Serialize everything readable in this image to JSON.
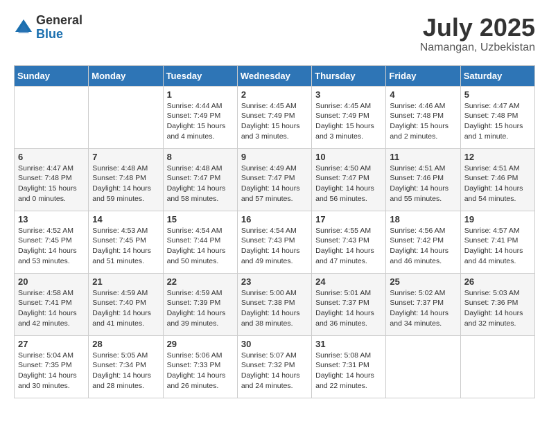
{
  "logo": {
    "general": "General",
    "blue": "Blue"
  },
  "title": "July 2025",
  "location": "Namangan, Uzbekistan",
  "days_header": [
    "Sunday",
    "Monday",
    "Tuesday",
    "Wednesday",
    "Thursday",
    "Friday",
    "Saturday"
  ],
  "weeks": [
    [
      {
        "num": "",
        "sunrise": "",
        "sunset": "",
        "daylight": ""
      },
      {
        "num": "",
        "sunrise": "",
        "sunset": "",
        "daylight": ""
      },
      {
        "num": "1",
        "sunrise": "Sunrise: 4:44 AM",
        "sunset": "Sunset: 7:49 PM",
        "daylight": "Daylight: 15 hours and 4 minutes."
      },
      {
        "num": "2",
        "sunrise": "Sunrise: 4:45 AM",
        "sunset": "Sunset: 7:49 PM",
        "daylight": "Daylight: 15 hours and 3 minutes."
      },
      {
        "num": "3",
        "sunrise": "Sunrise: 4:45 AM",
        "sunset": "Sunset: 7:49 PM",
        "daylight": "Daylight: 15 hours and 3 minutes."
      },
      {
        "num": "4",
        "sunrise": "Sunrise: 4:46 AM",
        "sunset": "Sunset: 7:48 PM",
        "daylight": "Daylight: 15 hours and 2 minutes."
      },
      {
        "num": "5",
        "sunrise": "Sunrise: 4:47 AM",
        "sunset": "Sunset: 7:48 PM",
        "daylight": "Daylight: 15 hours and 1 minute."
      }
    ],
    [
      {
        "num": "6",
        "sunrise": "Sunrise: 4:47 AM",
        "sunset": "Sunset: 7:48 PM",
        "daylight": "Daylight: 15 hours and 0 minutes."
      },
      {
        "num": "7",
        "sunrise": "Sunrise: 4:48 AM",
        "sunset": "Sunset: 7:48 PM",
        "daylight": "Daylight: 14 hours and 59 minutes."
      },
      {
        "num": "8",
        "sunrise": "Sunrise: 4:48 AM",
        "sunset": "Sunset: 7:47 PM",
        "daylight": "Daylight: 14 hours and 58 minutes."
      },
      {
        "num": "9",
        "sunrise": "Sunrise: 4:49 AM",
        "sunset": "Sunset: 7:47 PM",
        "daylight": "Daylight: 14 hours and 57 minutes."
      },
      {
        "num": "10",
        "sunrise": "Sunrise: 4:50 AM",
        "sunset": "Sunset: 7:47 PM",
        "daylight": "Daylight: 14 hours and 56 minutes."
      },
      {
        "num": "11",
        "sunrise": "Sunrise: 4:51 AM",
        "sunset": "Sunset: 7:46 PM",
        "daylight": "Daylight: 14 hours and 55 minutes."
      },
      {
        "num": "12",
        "sunrise": "Sunrise: 4:51 AM",
        "sunset": "Sunset: 7:46 PM",
        "daylight": "Daylight: 14 hours and 54 minutes."
      }
    ],
    [
      {
        "num": "13",
        "sunrise": "Sunrise: 4:52 AM",
        "sunset": "Sunset: 7:45 PM",
        "daylight": "Daylight: 14 hours and 53 minutes."
      },
      {
        "num": "14",
        "sunrise": "Sunrise: 4:53 AM",
        "sunset": "Sunset: 7:45 PM",
        "daylight": "Daylight: 14 hours and 51 minutes."
      },
      {
        "num": "15",
        "sunrise": "Sunrise: 4:54 AM",
        "sunset": "Sunset: 7:44 PM",
        "daylight": "Daylight: 14 hours and 50 minutes."
      },
      {
        "num": "16",
        "sunrise": "Sunrise: 4:54 AM",
        "sunset": "Sunset: 7:43 PM",
        "daylight": "Daylight: 14 hours and 49 minutes."
      },
      {
        "num": "17",
        "sunrise": "Sunrise: 4:55 AM",
        "sunset": "Sunset: 7:43 PM",
        "daylight": "Daylight: 14 hours and 47 minutes."
      },
      {
        "num": "18",
        "sunrise": "Sunrise: 4:56 AM",
        "sunset": "Sunset: 7:42 PM",
        "daylight": "Daylight: 14 hours and 46 minutes."
      },
      {
        "num": "19",
        "sunrise": "Sunrise: 4:57 AM",
        "sunset": "Sunset: 7:41 PM",
        "daylight": "Daylight: 14 hours and 44 minutes."
      }
    ],
    [
      {
        "num": "20",
        "sunrise": "Sunrise: 4:58 AM",
        "sunset": "Sunset: 7:41 PM",
        "daylight": "Daylight: 14 hours and 42 minutes."
      },
      {
        "num": "21",
        "sunrise": "Sunrise: 4:59 AM",
        "sunset": "Sunset: 7:40 PM",
        "daylight": "Daylight: 14 hours and 41 minutes."
      },
      {
        "num": "22",
        "sunrise": "Sunrise: 4:59 AM",
        "sunset": "Sunset: 7:39 PM",
        "daylight": "Daylight: 14 hours and 39 minutes."
      },
      {
        "num": "23",
        "sunrise": "Sunrise: 5:00 AM",
        "sunset": "Sunset: 7:38 PM",
        "daylight": "Daylight: 14 hours and 38 minutes."
      },
      {
        "num": "24",
        "sunrise": "Sunrise: 5:01 AM",
        "sunset": "Sunset: 7:37 PM",
        "daylight": "Daylight: 14 hours and 36 minutes."
      },
      {
        "num": "25",
        "sunrise": "Sunrise: 5:02 AM",
        "sunset": "Sunset: 7:37 PM",
        "daylight": "Daylight: 14 hours and 34 minutes."
      },
      {
        "num": "26",
        "sunrise": "Sunrise: 5:03 AM",
        "sunset": "Sunset: 7:36 PM",
        "daylight": "Daylight: 14 hours and 32 minutes."
      }
    ],
    [
      {
        "num": "27",
        "sunrise": "Sunrise: 5:04 AM",
        "sunset": "Sunset: 7:35 PM",
        "daylight": "Daylight: 14 hours and 30 minutes."
      },
      {
        "num": "28",
        "sunrise": "Sunrise: 5:05 AM",
        "sunset": "Sunset: 7:34 PM",
        "daylight": "Daylight: 14 hours and 28 minutes."
      },
      {
        "num": "29",
        "sunrise": "Sunrise: 5:06 AM",
        "sunset": "Sunset: 7:33 PM",
        "daylight": "Daylight: 14 hours and 26 minutes."
      },
      {
        "num": "30",
        "sunrise": "Sunrise: 5:07 AM",
        "sunset": "Sunset: 7:32 PM",
        "daylight": "Daylight: 14 hours and 24 minutes."
      },
      {
        "num": "31",
        "sunrise": "Sunrise: 5:08 AM",
        "sunset": "Sunset: 7:31 PM",
        "daylight": "Daylight: 14 hours and 22 minutes."
      },
      {
        "num": "",
        "sunrise": "",
        "sunset": "",
        "daylight": ""
      },
      {
        "num": "",
        "sunrise": "",
        "sunset": "",
        "daylight": ""
      }
    ]
  ]
}
